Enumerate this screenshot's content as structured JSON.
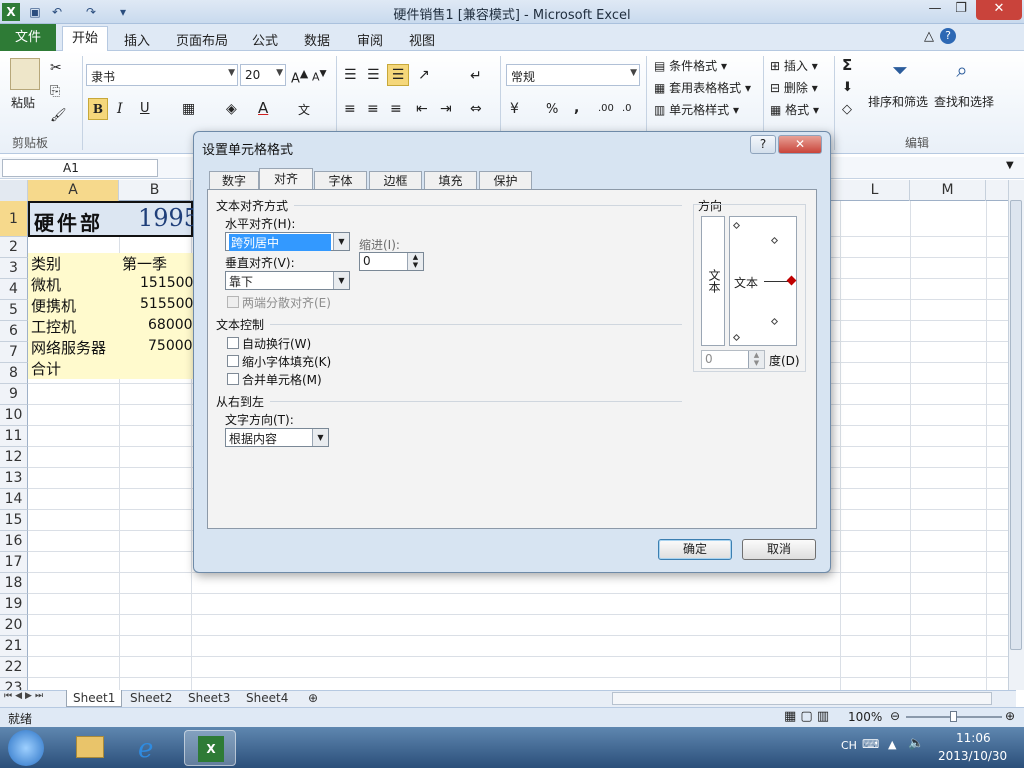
{
  "window": {
    "title": "硬件销售1  [兼容模式] - Microsoft Excel"
  },
  "ribbon_tabs": [
    "文件",
    "开始",
    "插入",
    "页面布局",
    "公式",
    "数据",
    "审阅",
    "视图"
  ],
  "ribbon": {
    "paste": "粘贴",
    "font_name": "隶书",
    "font_size": "20",
    "number_format": "常规",
    "cond_format": "条件格式",
    "table_format": "套用表格格式",
    "cell_style": "单元格样式",
    "insert": "插入",
    "delete": "删除",
    "format": "格式",
    "sort_filter": "排序和筛选",
    "find_select": "查找和选择",
    "groups": {
      "clipboard": "剪贴板",
      "editing": "编辑"
    },
    "bold": "B",
    "italic": "I",
    "underline": "U",
    "sum_symbol": "Σ",
    "percent": "%",
    "comma": ","
  },
  "formula_bar": {
    "name_box": "A1"
  },
  "columns": [
    "A",
    "B",
    "L",
    "M"
  ],
  "rows": [
    "1",
    "2",
    "3",
    "4",
    "5",
    "6",
    "7",
    "8",
    "9",
    "10",
    "11",
    "12",
    "13",
    "14",
    "15",
    "16",
    "17",
    "18",
    "19",
    "20",
    "21",
    "22",
    "23"
  ],
  "cells": {
    "a1": "硬件部",
    "b1": "1995",
    "a3": "类别",
    "b3": "第一季",
    "a4": "微机",
    "b4": "151500",
    "a5": "便携机",
    "b5": "515500",
    "a6": "工控机",
    "b6": "68000",
    "a7": "网络服务器",
    "b7": "75000",
    "a8": "合计"
  },
  "sheets": [
    "Sheet1",
    "Sheet2",
    "Sheet3",
    "Sheet4"
  ],
  "status": {
    "ready": "就绪",
    "zoom": "100%"
  },
  "taskbar": {
    "lang": "CH",
    "time": "11:06",
    "date": "2013/10/30"
  },
  "dialog": {
    "title": "设置单元格格式",
    "help": "?",
    "tabs": [
      "数字",
      "对齐",
      "字体",
      "边框",
      "填充",
      "保护"
    ],
    "section_text_align": "文本对齐方式",
    "horizontal_label": "水平对齐(H):",
    "horizontal_value": "跨列居中",
    "indent_label": "缩进(I):",
    "indent_value": "0",
    "vertical_label": "垂直对齐(V):",
    "vertical_value": "靠下",
    "distributed_label": "两端分散对齐(E)",
    "section_text_control": "文本控制",
    "wrap_label": "自动换行(W)",
    "shrink_label": "缩小字体填充(K)",
    "merge_label": "合并单元格(M)",
    "section_rtl": "从右到左",
    "direction_label": "文字方向(T):",
    "direction_value": "根据内容",
    "orientation_title": "方向",
    "orientation_vertical_text": "文本",
    "orientation_text": "文本",
    "degree_value": "0",
    "degree_label": "度(D)",
    "ok": "确定",
    "cancel": "取消"
  },
  "colors": {
    "file_tab": "#2e7b36",
    "selection": "#3399ff",
    "cell_fill": "#fffacd",
    "title_fill": "#dce6f2",
    "title_text": "#1f3f7a"
  }
}
